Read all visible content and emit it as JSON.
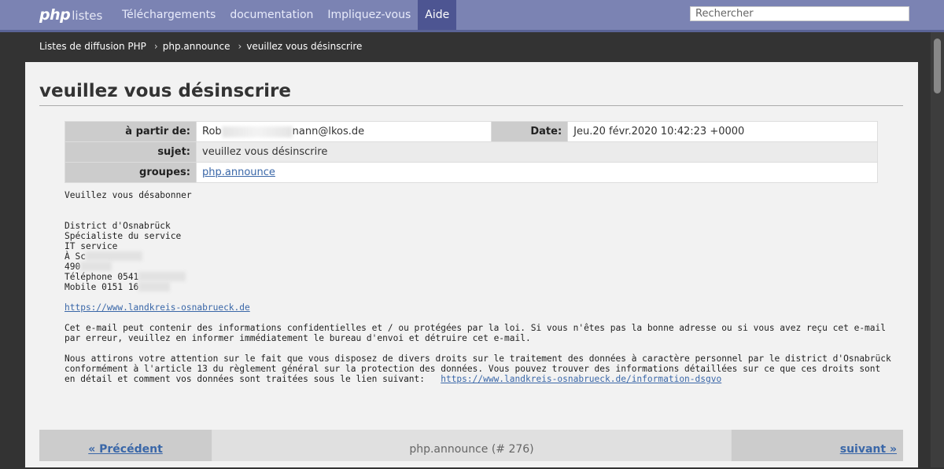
{
  "nav": {
    "logo_php": "php",
    "logo_text": "listes",
    "links": [
      "Téléchargements",
      "documentation",
      "Impliquez-vous",
      "Aide"
    ],
    "active_index": 3,
    "search_placeholder": "Rechercher"
  },
  "breadcrumb": [
    "Listes de diffusion PHP",
    "php.announce",
    "veuillez vous désinscrire"
  ],
  "message": {
    "title": "veuillez vous désinscrire",
    "from_label": "à partir de:",
    "from_prefix": "Rob",
    "from_suffix": "nann@lkos.de",
    "date_label": "Date:",
    "date_value": "Jeu.20 févr.2020 10:42:23 +0000",
    "subject_label": "sujet:",
    "subject_value": "veuillez vous désinscrire",
    "groups_label": "groupes:",
    "groups_value": "php.announce",
    "body_greeting": "Veuillez vous désabonner",
    "sig_line1": "District d'Osnabrück",
    "sig_line2": "Spécialiste du service",
    "sig_line3": "IT service",
    "sig_line4": "À Sc",
    "sig_line5": "490",
    "sig_line6": "Téléphone 0541",
    "sig_line7": "Mobile 0151 16",
    "website": "https://www.landkreis-osnabrueck.de",
    "para1": "Cet e-mail peut contenir des informations confidentielles et / ou protégées par la loi. Si vous n'êtes pas la bonne adresse ou si vous avez reçu cet e-mail\npar erreur, veuillez en informer immédiatement le bureau d'envoi et détruire cet e-mail.",
    "para2": "Nous attirons votre attention sur le fait que vous disposez de divers droits sur le traitement des données à caractère personnel par le district d'Osnabrück\nconformément à l'article 13 du règlement général sur la protection des données. Vous pouvez trouver des informations détaillées sur ce que ces droits sont\nen détail et comment vos données sont traitées sous le lien suivant:   ",
    "dsgvo_link": "https://www.landkreis-osnabrueck.de/information-dsgvo"
  },
  "pager": {
    "prev": "« Précédent",
    "middle": "php.announce (# 276)",
    "next": "suivant »"
  }
}
